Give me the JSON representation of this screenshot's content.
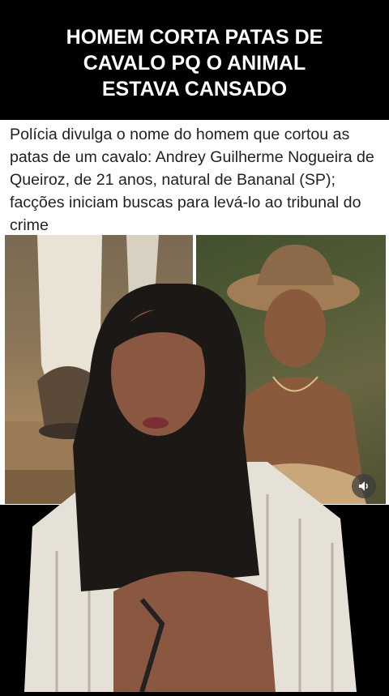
{
  "headline": {
    "text": "HOMEM CORTA PATAS DE CAVALO PQ O ANIMAL ESTAVA CANSADO"
  },
  "article": {
    "text": "Polícia divulga o nome do homem que cortou as patas de um cavalo: Andrey Guilherme Nogueira de Queiroz, de 21 anos, natural de Bananal (SP); facções iniciam buscas para levá-lo ao tribunal do crime"
  },
  "icons": {
    "sound": "speaker-icon"
  },
  "colors": {
    "headline_bg": "#000000",
    "headline_text": "#ffffff",
    "article_bg": "#ffffff",
    "article_text": "#222222"
  }
}
